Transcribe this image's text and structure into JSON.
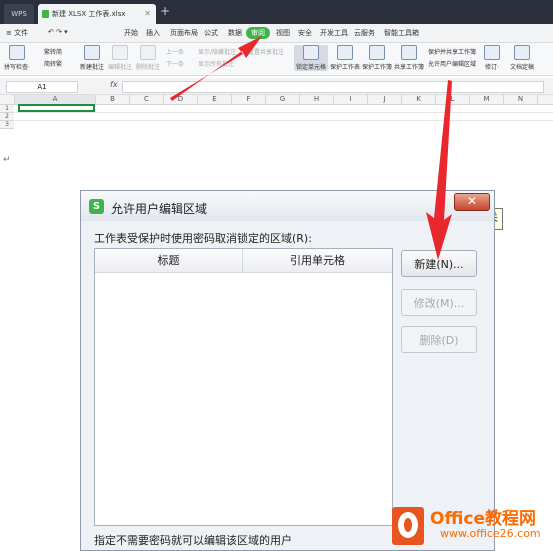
{
  "titlebar": {
    "wps_tab": "WPS",
    "doc_tab": "新建 XLSX 工作表.xlsx",
    "add_tab": "+"
  },
  "menubar": {
    "file": "≡ 文件",
    "items": [
      "开始",
      "插入",
      "页面布局",
      "公式",
      "数据",
      "审阅",
      "视图",
      "安全",
      "开发工具",
      "云服务",
      "智能工具箱"
    ],
    "active": "审阅"
  },
  "ribbon": {
    "spell_check": "拼写检查·",
    "trad_simp": "繁转简",
    "simp_trad": "简转繁",
    "new_comment": "新建批注",
    "edit_comment": "编辑批注",
    "delete_comment": "删除批注",
    "prev": "上一条",
    "next": "下一条",
    "show_hide": "显示/隐藏批注",
    "show_all": "显示所有批注",
    "reset_shared": "重置共享批注",
    "lock_cell": "锁定单元格",
    "protect_sheet": "保护工作表",
    "protect_book": "保护工作簿",
    "share_book": "共享工作簿",
    "protect_share": "保护并共享工作簿",
    "allow_edit": "允许用户编辑区域",
    "revise": "修订·",
    "doc_finalize": "文档定稿"
  },
  "formulabar": {
    "namebox": "A1",
    "fx": "fx"
  },
  "grid": {
    "columns": [
      "A",
      "B",
      "C",
      "D",
      "E",
      "F",
      "G",
      "H",
      "I",
      "J",
      "K",
      "L",
      "M",
      "N"
    ],
    "rows": [
      "1",
      "2",
      "3"
    ]
  },
  "dialog": {
    "title": "允许用户编辑区域",
    "logo": "S",
    "close": "✕",
    "tooltip": "关",
    "label": "工作表受保护时使用密码取消锁定的区域(R):",
    "col_title": "标题",
    "col_ref": "引用单元格",
    "btn_new": "新建(N)...",
    "btn_edit": "修改(M)...",
    "btn_delete": "删除(D)",
    "footer": "指定不需要密码就可以编辑该区域的用户"
  },
  "watermark": {
    "text": "Office教程网",
    "url": "www.office26.com"
  },
  "colors": {
    "accent_green": "#3fb44a",
    "arrow_red": "#e8282d",
    "watermark_orange": "#ff6a00"
  }
}
